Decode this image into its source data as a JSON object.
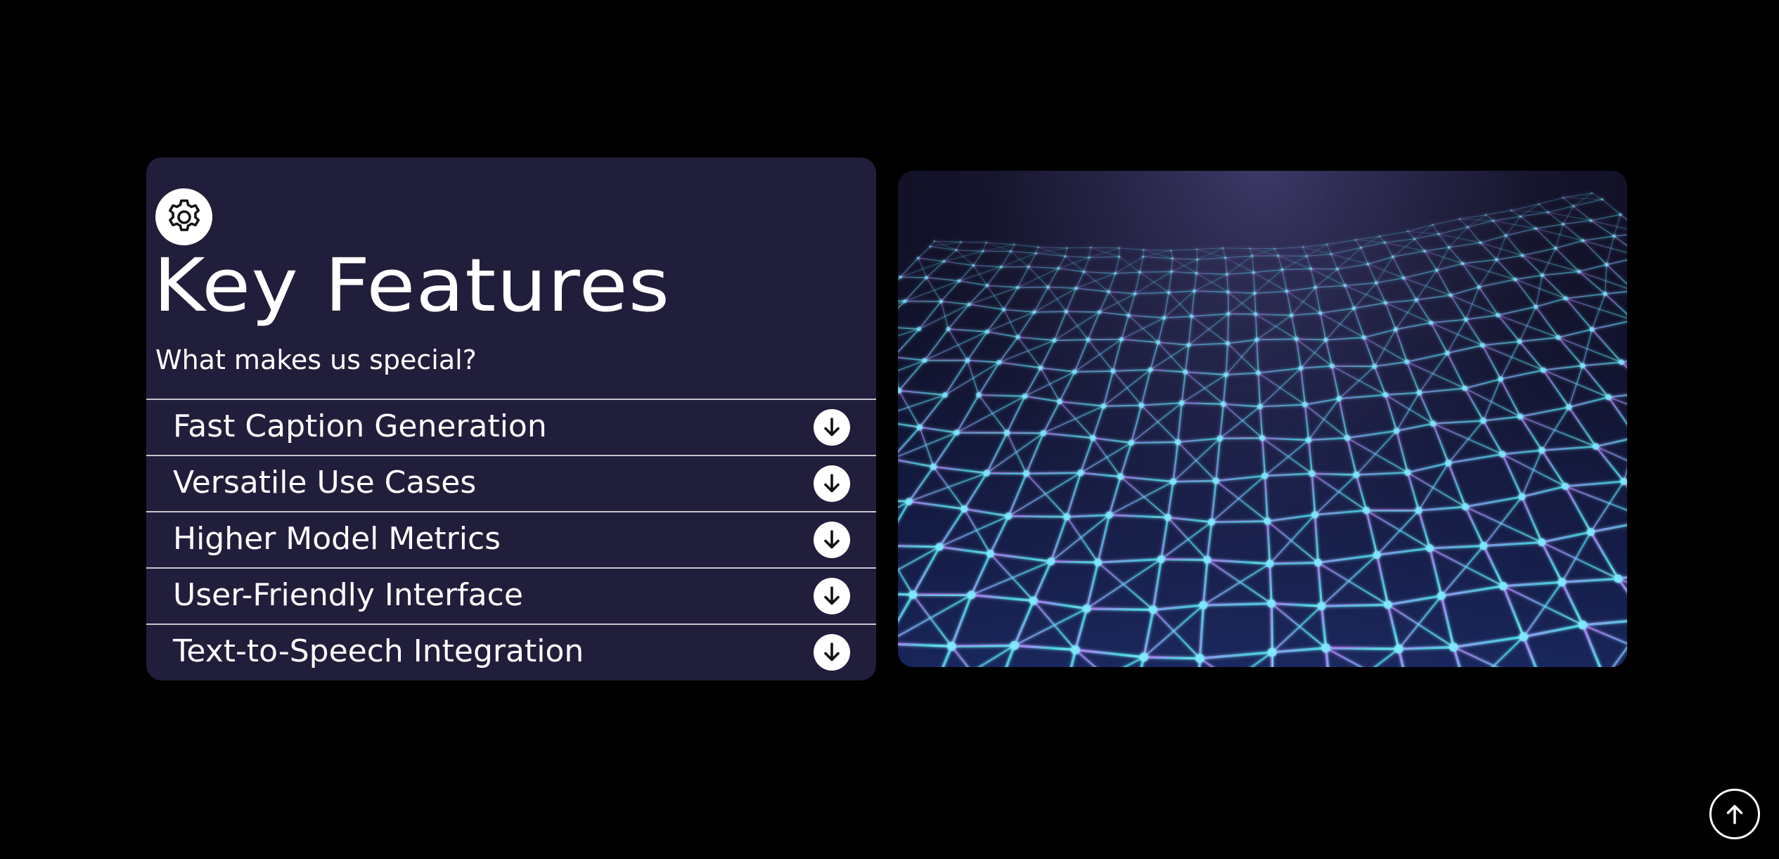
{
  "features": {
    "title": "Key Features",
    "subtitle": "What makes us special?",
    "icon": "gear-icon",
    "items": [
      {
        "label": "Fast Caption Generation",
        "icon": "arrow-down-icon"
      },
      {
        "label": "Versatile Use Cases",
        "icon": "arrow-down-icon"
      },
      {
        "label": "Higher Model Metrics",
        "icon": "arrow-down-icon"
      },
      {
        "label": "User-Friendly Interface",
        "icon": "arrow-down-icon"
      },
      {
        "label": "Text-to-Speech Integration",
        "icon": "arrow-down-icon"
      }
    ]
  },
  "scroll_top": {
    "icon": "arrow-up-icon"
  },
  "colors": {
    "page_background": "#000000",
    "card_background": "#211e3b",
    "text": "#ffffff",
    "mesh_cyan": "#4fe3f0",
    "mesh_violet": "#c77dff",
    "mesh_blue": "#3a7bd5"
  }
}
